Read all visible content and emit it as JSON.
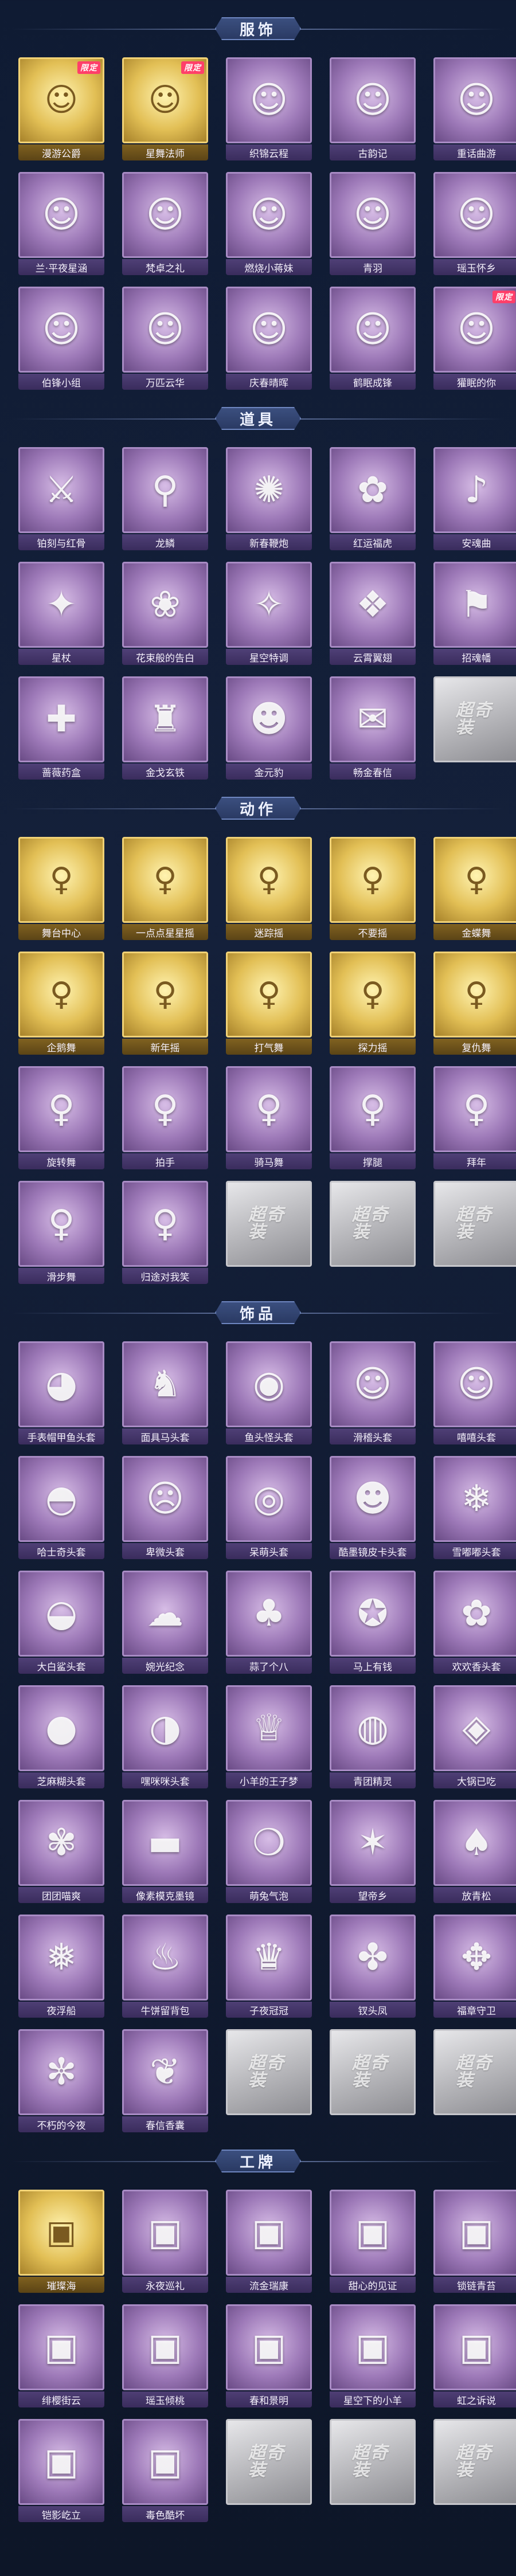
{
  "sections": [
    {
      "title": "服饰",
      "items": [
        {
          "name": "漫游公爵",
          "style": "gold",
          "icon": "☺",
          "badge": "限定"
        },
        {
          "name": "星舞法师",
          "style": "gold",
          "icon": "☺",
          "badge": "限定"
        },
        {
          "name": "织锦云程",
          "style": "purple",
          "icon": "☺",
          "badge": ""
        },
        {
          "name": "古韵记",
          "style": "purple",
          "icon": "☺",
          "badge": ""
        },
        {
          "name": "重话曲游",
          "style": "purple",
          "icon": "☺",
          "badge": ""
        },
        {
          "name": "兰·平夜星涵",
          "style": "purple",
          "icon": "☺",
          "badge": ""
        },
        {
          "name": "梵卓之礼",
          "style": "purple",
          "icon": "☺",
          "badge": ""
        },
        {
          "name": "燃烧小蒋妹",
          "style": "purple",
          "icon": "☺",
          "badge": ""
        },
        {
          "name": "青羽",
          "style": "purple",
          "icon": "☺",
          "badge": ""
        },
        {
          "name": "瑶玉怀乡",
          "style": "purple",
          "icon": "☺",
          "badge": ""
        },
        {
          "name": "伯锋小组",
          "style": "purple",
          "icon": "☺",
          "badge": ""
        },
        {
          "name": "万匹云华",
          "style": "purple",
          "icon": "☺",
          "badge": ""
        },
        {
          "name": "庆春晴晖",
          "style": "purple",
          "icon": "☺",
          "badge": ""
        },
        {
          "name": "鹤眠成锋",
          "style": "purple",
          "icon": "☺",
          "badge": ""
        },
        {
          "name": "獾眠的你",
          "style": "purple",
          "icon": "☺",
          "badge": "限定"
        }
      ]
    },
    {
      "title": "道具",
      "items": [
        {
          "name": "铂刻与红骨",
          "style": "purple",
          "icon": "⚔",
          "badge": ""
        },
        {
          "name": "龙鳞",
          "style": "purple",
          "icon": "⚲",
          "badge": ""
        },
        {
          "name": "新春鞭炮",
          "style": "purple",
          "icon": "✺",
          "badge": ""
        },
        {
          "name": "红运福虎",
          "style": "purple",
          "icon": "✿",
          "badge": ""
        },
        {
          "name": "安魂曲",
          "style": "purple",
          "icon": "♪",
          "badge": ""
        },
        {
          "name": "星杖",
          "style": "purple",
          "icon": "✦",
          "badge": ""
        },
        {
          "name": "花束般的告白",
          "style": "purple",
          "icon": "❀",
          "badge": ""
        },
        {
          "name": "星空特调",
          "style": "purple",
          "icon": "✧",
          "badge": ""
        },
        {
          "name": "云霄翼翅",
          "style": "purple",
          "icon": "❖",
          "badge": ""
        },
        {
          "name": "招魂幡",
          "style": "purple",
          "icon": "⚑",
          "badge": ""
        },
        {
          "name": "蔷薇药盒",
          "style": "purple",
          "icon": "✚",
          "badge": ""
        },
        {
          "name": "金戈玄铁",
          "style": "purple",
          "icon": "♜",
          "badge": ""
        },
        {
          "name": "金元豹",
          "style": "purple",
          "icon": "☻",
          "badge": ""
        },
        {
          "name": "畅金春信",
          "style": "purple",
          "icon": "✉",
          "badge": ""
        },
        {
          "name": "",
          "style": "empty",
          "icon": "超奇装",
          "badge": ""
        }
      ]
    },
    {
      "title": "动作",
      "items": [
        {
          "name": "舞台中心",
          "style": "gold",
          "icon": "♀",
          "badge": ""
        },
        {
          "name": "一点点星星摇",
          "style": "gold",
          "icon": "♀",
          "badge": ""
        },
        {
          "name": "迷踪摇",
          "style": "gold",
          "icon": "♀",
          "badge": ""
        },
        {
          "name": "不要摇",
          "style": "gold",
          "icon": "♀",
          "badge": ""
        },
        {
          "name": "金蝶舞",
          "style": "gold",
          "icon": "♀",
          "badge": ""
        },
        {
          "name": "企鹅舞",
          "style": "gold",
          "icon": "♀",
          "badge": ""
        },
        {
          "name": "新年摇",
          "style": "gold",
          "icon": "♀",
          "badge": ""
        },
        {
          "name": "打气舞",
          "style": "gold",
          "icon": "♀",
          "badge": ""
        },
        {
          "name": "探力摇",
          "style": "gold",
          "icon": "♀",
          "badge": ""
        },
        {
          "name": "复仇舞",
          "style": "gold",
          "icon": "♀",
          "badge": ""
        },
        {
          "name": "旋转舞",
          "style": "purple",
          "icon": "♀",
          "badge": ""
        },
        {
          "name": "拍手",
          "style": "purple",
          "icon": "♀",
          "badge": ""
        },
        {
          "name": "骑马舞",
          "style": "purple",
          "icon": "♀",
          "badge": ""
        },
        {
          "name": "撑腿",
          "style": "purple",
          "icon": "♀",
          "badge": ""
        },
        {
          "name": "拜年",
          "style": "purple",
          "icon": "♀",
          "badge": ""
        },
        {
          "name": "滑步舞",
          "style": "purple",
          "icon": "♀",
          "badge": ""
        },
        {
          "name": "归途对我笑",
          "style": "purple",
          "icon": "♀",
          "badge": ""
        },
        {
          "name": "",
          "style": "empty",
          "icon": "超奇装",
          "badge": ""
        },
        {
          "name": "",
          "style": "empty",
          "icon": "超奇装",
          "badge": ""
        },
        {
          "name": "",
          "style": "empty",
          "icon": "超奇装",
          "badge": ""
        }
      ]
    },
    {
      "title": "饰品",
      "items": [
        {
          "name": "手表帽甲鱼头套",
          "style": "purple",
          "icon": "◕",
          "badge": ""
        },
        {
          "name": "面具马头套",
          "style": "purple",
          "icon": "♞",
          "badge": ""
        },
        {
          "name": "鱼头怪头套",
          "style": "purple",
          "icon": "◉",
          "badge": ""
        },
        {
          "name": "滑稽头套",
          "style": "purple",
          "icon": "☺",
          "badge": ""
        },
        {
          "name": "嘻嘻头套",
          "style": "purple",
          "icon": "☺",
          "badge": ""
        },
        {
          "name": "哈士奇头套",
          "style": "purple",
          "icon": "◓",
          "badge": ""
        },
        {
          "name": "卑微头套",
          "style": "purple",
          "icon": "☹",
          "badge": ""
        },
        {
          "name": "呆萌头套",
          "style": "purple",
          "icon": "◎",
          "badge": ""
        },
        {
          "name": "酷墨镜皮卡头套",
          "style": "purple",
          "icon": "☻",
          "badge": ""
        },
        {
          "name": "雪嘟嘟头套",
          "style": "purple",
          "icon": "❄",
          "badge": ""
        },
        {
          "name": "大白鲨头套",
          "style": "purple",
          "icon": "◒",
          "badge": ""
        },
        {
          "name": "婉光纪念",
          "style": "purple",
          "icon": "☁",
          "badge": ""
        },
        {
          "name": "蒜了个八",
          "style": "purple",
          "icon": "♣",
          "badge": ""
        },
        {
          "name": "马上有钱",
          "style": "purple",
          "icon": "✪",
          "badge": ""
        },
        {
          "name": "欢欢香头套",
          "style": "purple",
          "icon": "✿",
          "badge": ""
        },
        {
          "name": "芝麻糊头套",
          "style": "purple",
          "icon": "●",
          "badge": ""
        },
        {
          "name": "嘿咪咪头套",
          "style": "purple",
          "icon": "◑",
          "badge": ""
        },
        {
          "name": "小羊的王子梦",
          "style": "purple",
          "icon": "♕",
          "badge": ""
        },
        {
          "name": "青团精灵",
          "style": "purple",
          "icon": "◍",
          "badge": ""
        },
        {
          "name": "大锅已吃",
          "style": "purple",
          "icon": "◈",
          "badge": ""
        },
        {
          "name": "团团喵爽",
          "style": "purple",
          "icon": "✾",
          "badge": ""
        },
        {
          "name": "像素模克墨镜",
          "style": "purple",
          "icon": "▬",
          "badge": ""
        },
        {
          "name": "萌兔气泡",
          "style": "purple",
          "icon": "❍",
          "badge": ""
        },
        {
          "name": "望帝乡",
          "style": "purple",
          "icon": "✶",
          "badge": ""
        },
        {
          "name": "放青松",
          "style": "purple",
          "icon": "♠",
          "badge": ""
        },
        {
          "name": "夜浮船",
          "style": "purple",
          "icon": "❅",
          "badge": ""
        },
        {
          "name": "牛饼留背包",
          "style": "purple",
          "icon": "♨",
          "badge": ""
        },
        {
          "name": "子夜冠冠",
          "style": "purple",
          "icon": "♛",
          "badge": ""
        },
        {
          "name": "钗头凤",
          "style": "purple",
          "icon": "✤",
          "badge": ""
        },
        {
          "name": "福章守卫",
          "style": "purple",
          "icon": "✥",
          "badge": ""
        },
        {
          "name": "不朽的今夜",
          "style": "purple",
          "icon": "✼",
          "badge": ""
        },
        {
          "name": "春信香囊",
          "style": "purple",
          "icon": "❦",
          "badge": ""
        },
        {
          "name": "",
          "style": "empty",
          "icon": "超奇装",
          "badge": ""
        },
        {
          "name": "",
          "style": "empty",
          "icon": "超奇装",
          "badge": ""
        },
        {
          "name": "",
          "style": "empty",
          "icon": "超奇装",
          "badge": ""
        }
      ]
    },
    {
      "title": "工牌",
      "items": [
        {
          "name": "璀璨海",
          "style": "gold",
          "icon": "▣",
          "badge": ""
        },
        {
          "name": "永夜巡礼",
          "style": "purple",
          "icon": "▣",
          "badge": ""
        },
        {
          "name": "流金瑞康",
          "style": "purple",
          "icon": "▣",
          "badge": ""
        },
        {
          "name": "甜心的见证",
          "style": "purple",
          "icon": "▣",
          "badge": ""
        },
        {
          "name": "锁链青苔",
          "style": "purple",
          "icon": "▣",
          "badge": ""
        },
        {
          "name": "绯樱街云",
          "style": "purple",
          "icon": "▣",
          "badge": ""
        },
        {
          "name": "瑶玉倾桃",
          "style": "purple",
          "icon": "▣",
          "badge": ""
        },
        {
          "name": "春和景明",
          "style": "purple",
          "icon": "▣",
          "badge": ""
        },
        {
          "name": "星空下的小羊",
          "style": "purple",
          "icon": "▣",
          "badge": ""
        },
        {
          "name": "虹之诉说",
          "style": "purple",
          "icon": "▣",
          "badge": ""
        },
        {
          "name": "铠影屹立",
          "style": "purple",
          "icon": "▣",
          "badge": ""
        },
        {
          "name": "毒色酷坏",
          "style": "purple",
          "icon": "▣",
          "badge": ""
        },
        {
          "name": "",
          "style": "empty",
          "icon": "超奇装",
          "badge": ""
        },
        {
          "name": "",
          "style": "empty",
          "icon": "超奇装",
          "badge": ""
        },
        {
          "name": "",
          "style": "empty",
          "icon": "超奇装",
          "badge": ""
        }
      ]
    }
  ]
}
